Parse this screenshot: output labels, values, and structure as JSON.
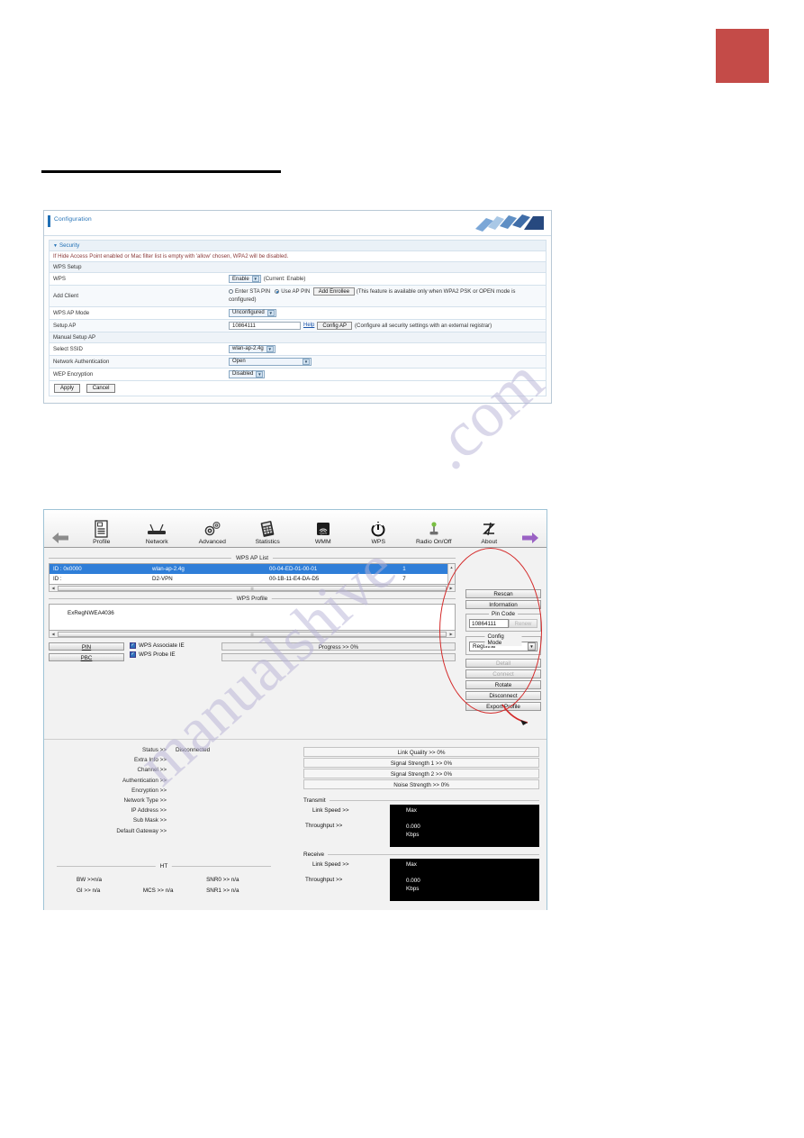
{
  "page": {
    "watermark_a": ".com",
    "watermark_b": "manualshive"
  },
  "config_panel": {
    "title": "Configuration",
    "section": "Security",
    "notice": "If Hide Access Point enabled or Mac filter list is empty with 'allow' chosen, WPA2 will be disabled.",
    "group_wps_setup": "WPS Setup",
    "group_manual_setup": "Manual Setup AP",
    "rows": {
      "wps": {
        "label": "WPS",
        "value": "Enable",
        "hint": "(Current: Enable)"
      },
      "add_client": {
        "label": "Add Client",
        "radio_sta": "Enter STA PIN",
        "radio_ap": "Use AP PIN",
        "button": "Add Enrollee",
        "hint": "(This feature is available only when WPA2 PSK or OPEN mode is configured)"
      },
      "wps_ap_mode": {
        "label": "WPS AP Mode",
        "value": "Unconfigured"
      },
      "setup_ap": {
        "label": "Setup AP",
        "value": "10864111",
        "help": "Help",
        "button": "Config AP",
        "hint": "(Configure all security settings with an external registrar)"
      },
      "select_ssid": {
        "label": "Select SSID",
        "value": "wlan-ap-2.4g"
      },
      "network_auth": {
        "label": "Network Authentication",
        "value": "Open"
      },
      "wep_encryption": {
        "label": "WEP Encryption",
        "value": "Disabled"
      }
    },
    "apply_label": "Apply",
    "cancel_label": "Cancel",
    "accent_color": "#1f6fb5",
    "notice_color": "#8a3a3a"
  },
  "wps_utility": {
    "toolbar": [
      {
        "label": "Profile",
        "icon": "document-icon"
      },
      {
        "label": "Network",
        "icon": "router-icon"
      },
      {
        "label": "Advanced",
        "icon": "gears-icon"
      },
      {
        "label": "Statistics",
        "icon": "chart-icon"
      },
      {
        "label": "WMM",
        "icon": "qos-icon"
      },
      {
        "label": "WPS",
        "icon": "wps-icon"
      },
      {
        "label": "Radio On/Off",
        "icon": "antenna-icon"
      },
      {
        "label": "About",
        "icon": "signature-icon"
      }
    ],
    "nav_back": "back-arrow-icon",
    "nav_forward": "forward-arrow-icon",
    "ap_list": {
      "legend": "WPS AP List",
      "rows": [
        {
          "id": "ID : 0x0000",
          "ssid": "wlan-ap-2.4g",
          "mac": "00-04-ED-01-00-01",
          "channel": "1",
          "selected": true
        },
        {
          "id": "ID :",
          "ssid": "D2-VPN",
          "mac": "00-1B-11-E4-DA-D5",
          "channel": "7",
          "selected": false
        }
      ]
    },
    "profile": {
      "legend": "WPS Profile",
      "name": "ExRegNWEA4036"
    },
    "controls": {
      "pin_label": "PIN",
      "pbc_label": "PBC",
      "associate_ie": "WPS Associate IE",
      "probe_ie": "WPS Probe IE",
      "progress": "Progress >> 0%"
    },
    "side_buttons": {
      "rescan": "Rescan",
      "information": "Information",
      "pin_code_legend": "Pin Code",
      "pin_code_value": "10864111",
      "renew": "Renew",
      "config_mode_legend": "Config Mode",
      "config_mode_value": "Registrar",
      "detail": "Detail",
      "connect": "Connect",
      "rotate": "Rotate",
      "disconnect": "Disconnect",
      "export_profile": "Export Profile"
    },
    "status": {
      "left": [
        {
          "key": "Status >>",
          "value": "Disconnected"
        },
        {
          "key": "Extra Info >>",
          "value": ""
        },
        {
          "key": "Channel >>",
          "value": ""
        },
        {
          "key": "Authentication >>",
          "value": ""
        },
        {
          "key": "Encryption >>",
          "value": ""
        },
        {
          "key": "Network Type >>",
          "value": ""
        },
        {
          "key": "IP Address >>",
          "value": ""
        },
        {
          "key": "Sub Mask >>",
          "value": ""
        },
        {
          "key": "Default Gateway >>",
          "value": ""
        }
      ],
      "ht_legend": "HT",
      "ht": {
        "bw": "BW >>n/a",
        "gi": "GI >> n/a",
        "mcs": "MCS >>  n/a",
        "snr0": "SNR0 >>  n/a",
        "snr1": "SNR1 >>  n/a"
      },
      "meters": [
        "Link Quality >> 0%",
        "Signal Strength 1 >> 0%",
        "Signal Strength 2 >> 0%",
        "Noise Strength >> 0%"
      ],
      "transmit": {
        "legend": "Transmit",
        "link_speed": "Link Speed >>",
        "throughput": "Throughput >>",
        "max": "Max",
        "value": "0.000",
        "unit": "Kbps"
      },
      "receive": {
        "legend": "Receive",
        "link_speed": "Link Speed >>",
        "throughput": "Throughput >>",
        "max": "Max",
        "value": "0.000",
        "unit": "Kbps"
      }
    },
    "annotation": {
      "shape": "red-ellipse",
      "color": "#d42a2a"
    }
  }
}
